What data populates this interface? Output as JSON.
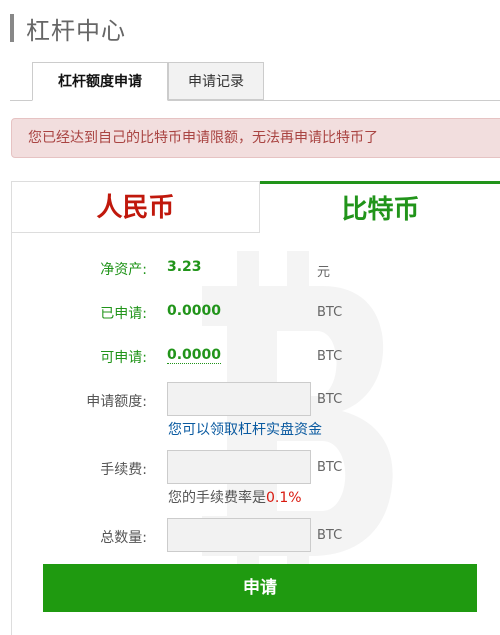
{
  "header": {
    "title": "杠杆中心"
  },
  "tabs": [
    {
      "label": "杠杆额度申请",
      "active": true
    },
    {
      "label": "申请记录",
      "active": false
    }
  ],
  "alert": {
    "message": "您已经达到自己的比特币申请限额，无法再申请比特币了"
  },
  "currency_tabs": [
    {
      "label": "人民币",
      "color": "#c0180c"
    },
    {
      "label": "比特币",
      "color": "#21941a",
      "active": true
    }
  ],
  "form": {
    "net_assets": {
      "label": "净资产:",
      "value": "3.23",
      "unit": "元"
    },
    "applied": {
      "label": "已申请:",
      "value": "0.0000",
      "unit": "BTC"
    },
    "available": {
      "label": "可申请:",
      "value": "0.0000",
      "unit": "BTC"
    },
    "amount": {
      "label": "申请额度:",
      "unit": "BTC",
      "value": ""
    },
    "amount_note": "您可以领取杠杆实盘资金",
    "fee": {
      "label": "手续费:",
      "unit": "BTC",
      "value": ""
    },
    "fee_note_prefix": "您的手续费率是",
    "fee_rate": "0.1%",
    "total": {
      "label": "总数量:",
      "unit": "BTC",
      "value": ""
    }
  },
  "submit_label": "申请",
  "colors": {
    "accent_green": "#21941a",
    "button_green": "#1f9a10",
    "cny_red": "#c0180c",
    "alert_bg": "#f2dede"
  }
}
